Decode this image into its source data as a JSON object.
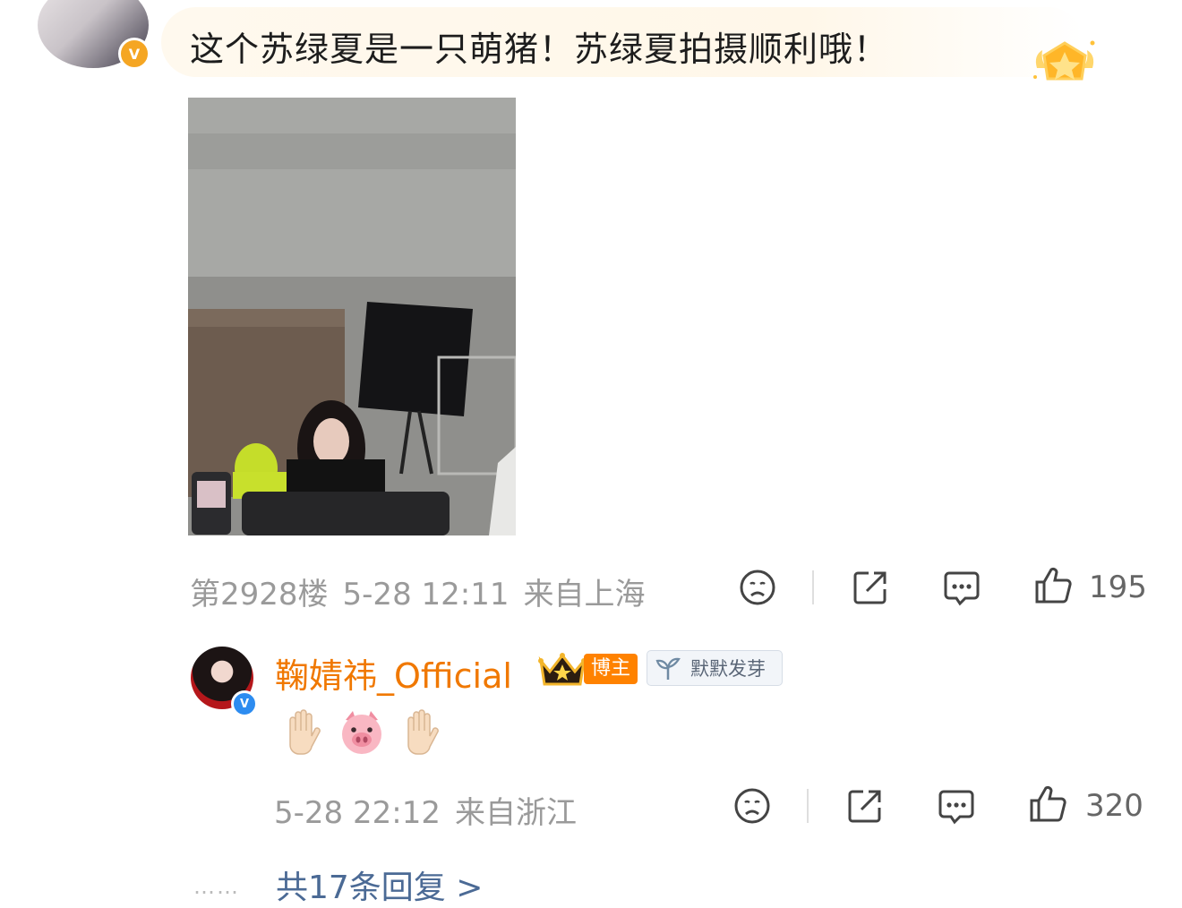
{
  "comment": {
    "text": "这个苏绿夏是一只萌猪！苏绿夏拍摄顺利哦！",
    "avatar_badge": "V",
    "meta": {
      "floor": "第2928楼",
      "date": "5-28 12:11",
      "location": "来自上海"
    },
    "likes": "195"
  },
  "reply": {
    "username": "鞠婧祎_Official",
    "avatar_badge": "V",
    "host_tag": "博主",
    "fan_tag": "默默发芽",
    "emojis": [
      "raised-hand-emoji",
      "pig-face-emoji",
      "raised-hand-emoji"
    ],
    "meta": {
      "date": "5-28 22:12",
      "location": "来自浙江"
    },
    "likes": "320"
  },
  "more_replies": "共17条回复 >",
  "more_dots": "……",
  "colors": {
    "username": "#f07800",
    "link": "#4b6a95",
    "meta_gray": "#9a9a9a",
    "badge_gold": "#f5a623",
    "badge_blue": "#2d8cf0"
  }
}
